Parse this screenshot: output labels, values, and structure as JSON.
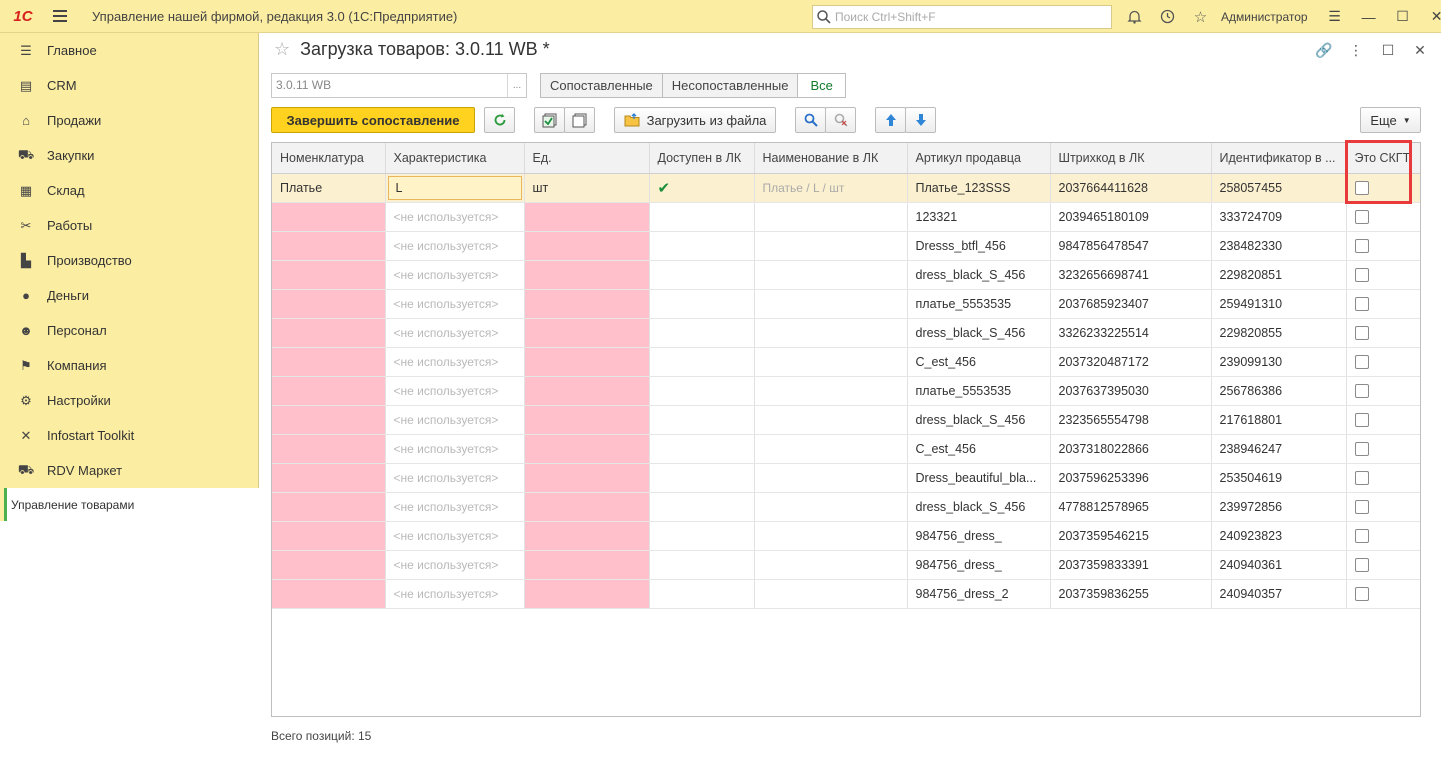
{
  "app": {
    "logo": "1С",
    "title": "Управление нашей фирмой, редакция 3.0  (1С:Предприятие)",
    "search_placeholder": "Поиск Ctrl+Shift+F",
    "user": "Администратор"
  },
  "sidebar": {
    "items": [
      {
        "label": "Главное",
        "icon": "menu-lines-icon"
      },
      {
        "label": "CRM",
        "icon": "contacts-card-icon"
      },
      {
        "label": "Продажи",
        "icon": "basket-icon"
      },
      {
        "label": "Закупки",
        "icon": "cart-icon"
      },
      {
        "label": "Склад",
        "icon": "grid-icon"
      },
      {
        "label": "Работы",
        "icon": "tools-icon"
      },
      {
        "label": "Производство",
        "icon": "factory-icon"
      },
      {
        "label": "Деньги",
        "icon": "coin-icon"
      },
      {
        "label": "Персонал",
        "icon": "person-icon"
      },
      {
        "label": "Компания",
        "icon": "flag-icon"
      },
      {
        "label": "Настройки",
        "icon": "gear-icon"
      },
      {
        "label": "Infostart Toolkit",
        "icon": "wrench-icon"
      },
      {
        "label": "RDV Маркет",
        "icon": "cart-icon"
      }
    ],
    "active": "Управление товарами"
  },
  "form": {
    "title": "Загрузка товаров: 3.0.11 WB *",
    "field_value": "3.0.11 WB",
    "field_dots": "...",
    "filters": [
      "Сопоставленные",
      "Несопоставленные",
      "Все"
    ],
    "filter_active": "Все",
    "finish_button": "Завершить сопоставление",
    "load_button": "Загрузить из файла",
    "more_button": "Еще",
    "footer_label": "Всего позиций:",
    "footer_count": "15"
  },
  "table": {
    "columns": [
      "Номенклатура",
      "Характеристика",
      "Ед.",
      "Доступен в ЛК",
      "Наименование в ЛК",
      "Артикул продавца",
      "Штрихкод в ЛК",
      "Идентификатор в ...",
      "Это СКГТ"
    ],
    "selected_row": {
      "nomenclature": "Платье",
      "characteristic": "L",
      "unit": "шт",
      "available": true,
      "name_in_lk": "Платье  / L / шт",
      "article": "Платье_123SSS",
      "barcode": "2037664411628",
      "id": "258057455"
    },
    "unused_label": "<не используется>",
    "rows": [
      {
        "article": "123321",
        "barcode": "2039465180109",
        "id": "333724709"
      },
      {
        "article": "Dresss_btfl_456",
        "barcode": "9847856478547",
        "id": "238482330"
      },
      {
        "article": "dress_black_S_456",
        "barcode": "3232656698741",
        "id": "229820851"
      },
      {
        "article": "платье_5553535",
        "barcode": "2037685923407",
        "id": "259491310"
      },
      {
        "article": "dress_black_S_456",
        "barcode": "3326233225514",
        "id": "229820855"
      },
      {
        "article": "C_est_456",
        "barcode": "2037320487172",
        "id": "239099130"
      },
      {
        "article": "платье_5553535",
        "barcode": "2037637395030",
        "id": "256786386"
      },
      {
        "article": "dress_black_S_456",
        "barcode": "2323565554798",
        "id": "217618801"
      },
      {
        "article": "C_est_456",
        "barcode": "2037318022866",
        "id": "238946247"
      },
      {
        "article": "Dress_beautiful_bla...",
        "barcode": "2037596253396",
        "id": "253504619"
      },
      {
        "article": "dress_black_S_456",
        "barcode": "4778812578965",
        "id": "239972856"
      },
      {
        "article": "984756_dress_",
        "barcode": "2037359546215",
        "id": "240923823"
      },
      {
        "article": "984756_dress_",
        "barcode": "2037359833391",
        "id": "240940361"
      },
      {
        "article": "984756_dress_2",
        "barcode": "2037359836255",
        "id": "240940357"
      }
    ]
  },
  "colors": {
    "topbar": "#fbeda2",
    "primary_button": "#ffd21f",
    "unmatched_cell": "#ffc0cb",
    "highlight_box": "#e83a3a",
    "active_filter": "#0f7a2d"
  }
}
